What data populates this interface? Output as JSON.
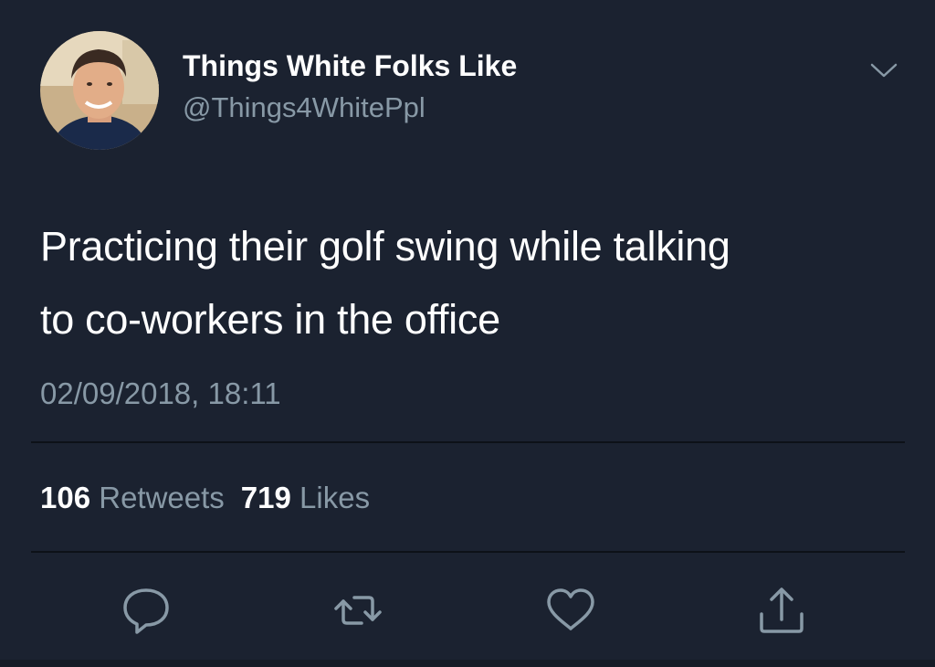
{
  "account": {
    "display_name": "Things White Folks Like",
    "handle": "@Things4WhitePpl"
  },
  "tweet": {
    "text_line_1": "Practicing their golf swing while talking",
    "text_line_2": "to co-workers in the office",
    "timestamp": "02/09/2018, 18:11"
  },
  "stats": {
    "retweets_count": "106",
    "retweets_label": "Retweets",
    "likes_count": "719",
    "likes_label": "Likes"
  },
  "icons": {
    "caret": "chevron-down-icon",
    "reply": "reply-icon",
    "retweet": "retweet-icon",
    "like": "heart-icon",
    "share": "share-icon"
  },
  "colors": {
    "background": "#1b2230",
    "primary_text": "#ffffff",
    "secondary_text": "#8899a6",
    "icon": "#8899a6"
  }
}
